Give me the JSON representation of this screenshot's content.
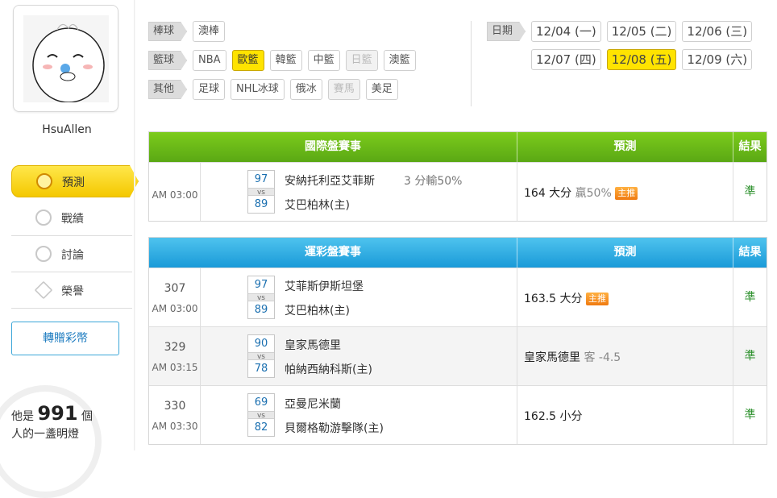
{
  "user": {
    "name": "HsuAllen"
  },
  "nav": [
    {
      "label": "預測",
      "icon": "target-icon"
    },
    {
      "label": "戰績",
      "icon": "record-icon"
    },
    {
      "label": "討論",
      "icon": "discussion-icon"
    },
    {
      "label": "榮譽",
      "icon": "star-icon"
    }
  ],
  "gift_button": "轉贈彩幣",
  "lamp": {
    "prefix": "他是",
    "count": "991",
    "suffix": "個",
    "line2": "人的一盞明燈"
  },
  "filters": {
    "baseball": {
      "label": "棒球",
      "options": [
        "澳棒"
      ]
    },
    "basketball": {
      "label": "籃球",
      "options": [
        "NBA",
        "歐籃",
        "韓籃",
        "中籃",
        "日籃",
        "澳籃"
      ]
    },
    "other": {
      "label": "其他",
      "options": [
        "足球",
        "NHL冰球",
        "俄冰",
        "賽馬",
        "美足"
      ]
    },
    "date": {
      "label": "日期",
      "row1": [
        "12/04 (一)",
        "12/05 (二)",
        "12/06 (三)"
      ],
      "row2": [
        "12/07 (四)",
        "12/08 (五)",
        "12/09 (六)"
      ]
    }
  },
  "intl": {
    "headers": [
      "國際盤賽事",
      "預測",
      "結果"
    ],
    "rows": [
      {
        "time": "AM 03:00",
        "score1": "97",
        "vs": "vs",
        "score2": "89",
        "team1": "安納托利亞艾菲斯",
        "team2": "艾巴柏林(主)",
        "extra": "3 分輸50%",
        "pred": "164 大分",
        "pred_sub": "贏50%",
        "badge": "主推",
        "result": "準"
      }
    ]
  },
  "lottery": {
    "headers": [
      "運彩盤賽事",
      "預測",
      "結果"
    ],
    "rows": [
      {
        "num": "307",
        "time": "AM 03:00",
        "score1": "97",
        "vs": "vs",
        "score2": "89",
        "team1": "艾菲斯伊斯坦堡",
        "team2": "艾巴柏林(主)",
        "pred": "163.5 大分",
        "pred_sub": "",
        "badge": "主推",
        "result": "準"
      },
      {
        "num": "329",
        "time": "AM 03:15",
        "score1": "90",
        "vs": "vs",
        "score2": "78",
        "team1": "皇家馬德里",
        "team2": "帕納西納科斯(主)",
        "pred": "皇家馬德里",
        "pred_sub": "客 -4.5",
        "badge": "",
        "result": "準"
      },
      {
        "num": "330",
        "time": "AM 03:30",
        "score1": "69",
        "vs": "vs",
        "score2": "82",
        "team1": "亞曼尼米蘭",
        "team2": "貝爾格勒游擊隊(主)",
        "pred": "162.5 小分",
        "pred_sub": "",
        "badge": "",
        "result": "準"
      }
    ]
  }
}
